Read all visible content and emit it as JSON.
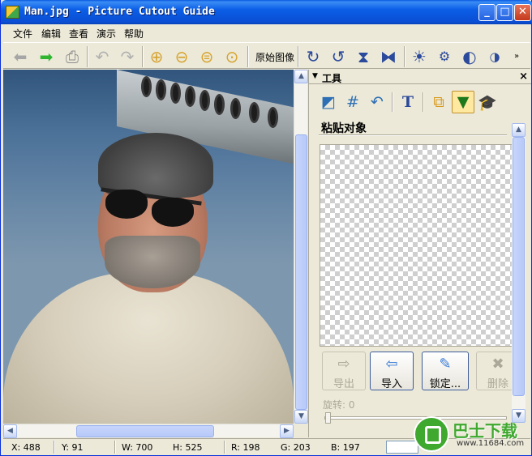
{
  "window": {
    "title": "Man.jpg - Picture Cutout Guide"
  },
  "title_buttons": {
    "minimize": "_",
    "maximize": "□",
    "close": "✕"
  },
  "menu": [
    "文件",
    "编辑",
    "查看",
    "演示",
    "帮助"
  ],
  "toolbar": {
    "icons": [
      "back-arrow",
      "forward-arrow",
      "print",
      "undo",
      "redo",
      "zoom-in",
      "zoom-out",
      "zoom-fit",
      "zoom-actual",
      "rotate-cw",
      "rotate-ccw",
      "flip-vertical",
      "flip-horizontal",
      "brightness",
      "settings",
      "contrast",
      "color-saturation"
    ],
    "original_image_label": "原始图像"
  },
  "panel": {
    "title": "工具",
    "close": "×",
    "section_title": "粘贴对象",
    "tools": [
      "select-crop-tool",
      "grid-tool",
      "undo-arrow-tool",
      "text-tool",
      "paste-object-tool",
      "tint-tool",
      "wizard-tool"
    ],
    "buttons": {
      "export": "导出",
      "import": "导入",
      "lock": "锁定...",
      "delete": "删除"
    },
    "rotate_label": "旋转: 0",
    "rotate_value": 0
  },
  "status": {
    "x": "X: 488",
    "y": "Y: 91",
    "w": "W: 700",
    "h": "H: 525",
    "r": "R: 198",
    "g": "G: 203",
    "b": "B: 197"
  },
  "watermark": {
    "text": "巴士下载",
    "url": "www.11684.com"
  },
  "colors": {
    "title_bar": "#0a5ae0",
    "face": "#ece9d8",
    "scroll_thumb": "#c6d5fb",
    "watermark_green": "#3fa82e"
  }
}
